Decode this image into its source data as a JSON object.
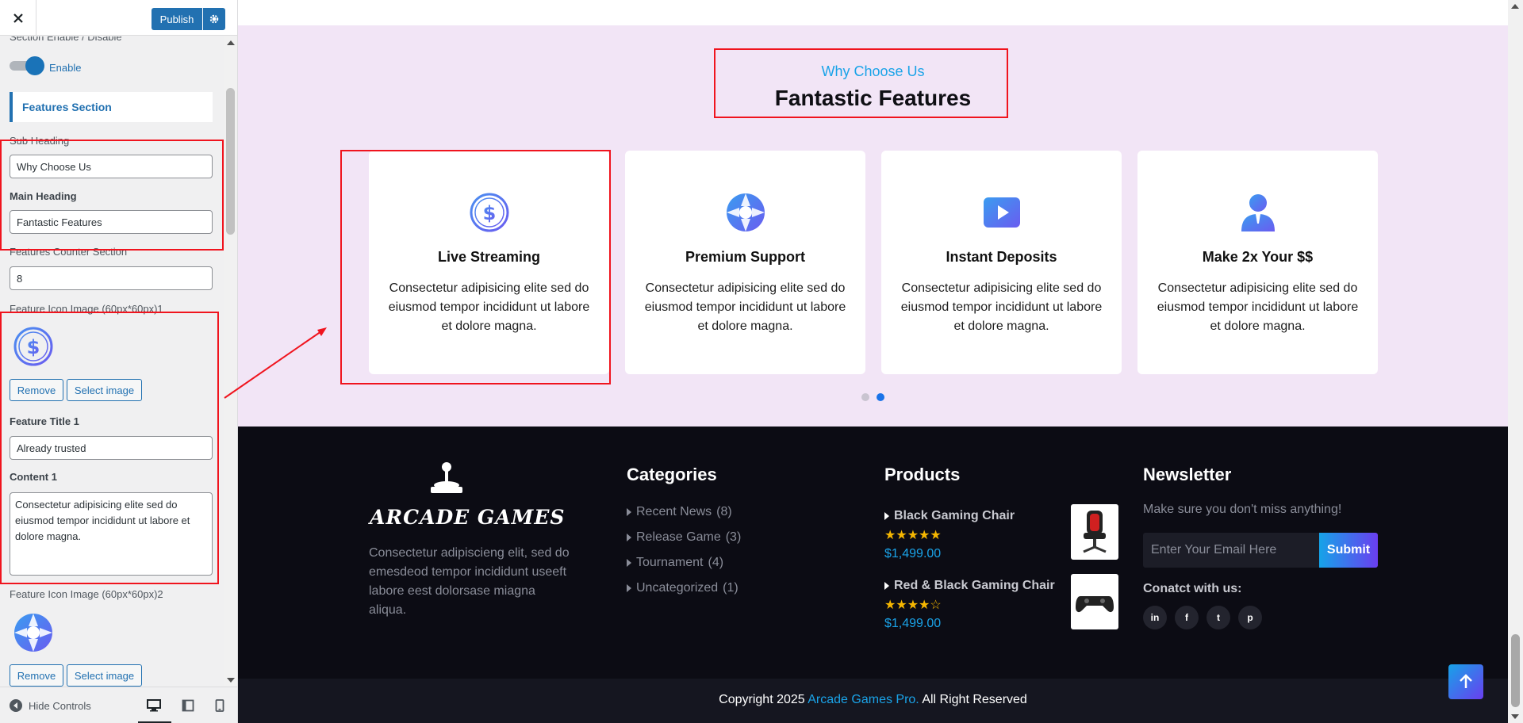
{
  "sidebar": {
    "close_icon": "close-icon",
    "publish_label": "Publish",
    "section_enable_label": "Section Enable / Disable",
    "toggle_label": "Enable",
    "section_title": "Features Section",
    "sub_heading_label": "Sub Heading",
    "sub_heading_value": "Why Choose Us",
    "main_heading_label": "Main Heading",
    "main_heading_value": "Fantastic Features",
    "counter_label": "Features Counter Section",
    "counter_value": "8",
    "icon_image_1_label": "Feature Icon Image (60px*60px)1",
    "remove_label": "Remove",
    "select_image_label": "Select image",
    "feature_title_1_label": "Feature Title 1",
    "feature_title_1_value": "Already trusted",
    "content_1_label": "Content 1",
    "content_1_value": "Consectetur adipisicing elite sed do eiusmod tempor incididunt ut labore et dolore magna.",
    "icon_image_2_label": "Feature Icon Image (60px*60px)2",
    "hide_controls_label": "Hide Controls"
  },
  "features": {
    "sub_heading": "Why Choose Us",
    "main_heading": "Fantastic Features",
    "cards": [
      {
        "icon": "dollar-icon",
        "title": "Live Streaming",
        "text": "Consectetur adipisicing elite sed do eiusmod tempor incididunt ut labore et dolore magna."
      },
      {
        "icon": "lifebuoy-icon",
        "title": "Premium Support",
        "text": "Consectetur adipisicing elite sed do eiusmod tempor incididunt ut labore et dolore magna."
      },
      {
        "icon": "play-icon",
        "title": "Instant Deposits",
        "text": "Consectetur adipisicing elite sed do eiusmod tempor incididunt ut labore et dolore magna."
      },
      {
        "icon": "user-icon",
        "title": "Make 2x Your $$",
        "text": "Consectetur adipisicing elite sed do eiusmod tempor incididunt ut labore et dolore magna."
      }
    ]
  },
  "footer": {
    "logo_text": "ARCADE GAMES",
    "about": "Consectetur adipiscieng elit, sed do emesdeod tempor incididunt useeft labore eest dolorsase miagna aliqua.",
    "categories_heading": "Categories",
    "categories": [
      {
        "name": "Recent News",
        "count": "(8)"
      },
      {
        "name": "Release Game",
        "count": "(3)"
      },
      {
        "name": "Tournament",
        "count": "(4)"
      },
      {
        "name": "Uncategorized",
        "count": "(1)"
      }
    ],
    "products_heading": "Products",
    "products": [
      {
        "name": "Black Gaming Chair",
        "stars": "★★★★★",
        "rating": 5,
        "price": "$1,499.00"
      },
      {
        "name": "Red & Black Gaming Chair",
        "stars": "★★★★☆",
        "rating": 4,
        "price": "$1,499.00"
      }
    ],
    "newsletter_heading": "Newsletter",
    "newsletter_desc": "Make sure you don't miss anything!",
    "email_placeholder": "Enter Your Email Here",
    "submit_label": "Submit",
    "contact_label": "Conatct with us:",
    "social": [
      "in",
      "f",
      "t",
      "p"
    ],
    "copyright_prefix": "Copyright 2025 ",
    "copyright_link": "Arcade Games Pro.",
    "copyright_suffix": " All Right Reserved"
  },
  "colors": {
    "accent": "#1aa3e8",
    "wp_blue": "#2271b1",
    "annotation_red": "#f0141e",
    "features_bg": "#f2e5f6",
    "footer_bg": "#0c0c14"
  }
}
